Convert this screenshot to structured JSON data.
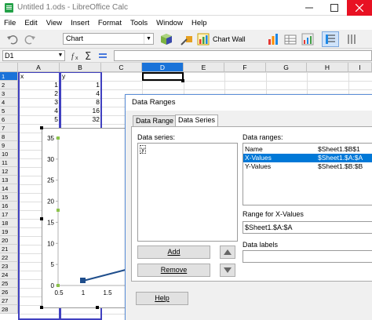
{
  "window": {
    "title": "Untitled 1.ods - LibreOffice Calc"
  },
  "menu": [
    "File",
    "Edit",
    "View",
    "Insert",
    "Format",
    "Tools",
    "Window",
    "Help"
  ],
  "toolbar": {
    "chart_select": "Chart",
    "chart_wall_label": "Chart Wall"
  },
  "formula_bar": {
    "name_box": "D1",
    "formula": ""
  },
  "sheet": {
    "columns": [
      "A",
      "B",
      "C",
      "D",
      "E",
      "F",
      "G",
      "H",
      "I"
    ],
    "selected_column": "D",
    "selected_row": "1",
    "rows": [
      "1",
      "2",
      "3",
      "4",
      "5",
      "6",
      "7",
      "8",
      "9",
      "10",
      "11",
      "12",
      "13",
      "14",
      "15",
      "16",
      "17",
      "18",
      "19",
      "20",
      "21",
      "22",
      "23",
      "24",
      "25",
      "26",
      "27",
      "28"
    ],
    "headers": {
      "a1": "x",
      "b1": "y"
    },
    "data": [
      {
        "x": "1",
        "y": "1"
      },
      {
        "x": "2",
        "y": "4"
      },
      {
        "x": "3",
        "y": "8"
      },
      {
        "x": "4",
        "y": "16"
      },
      {
        "x": "5",
        "y": "32"
      }
    ]
  },
  "chart": {
    "y_ticks": [
      "35",
      "30",
      "25",
      "20",
      "15",
      "10",
      "5",
      "0"
    ],
    "x_ticks": [
      "0.5",
      "1",
      "1.5"
    ]
  },
  "dialog": {
    "title": "Data Ranges",
    "tabs": [
      "Data Range",
      "Data Series"
    ],
    "active_tab": "Data Series",
    "data_series_label": "Data series:",
    "data_series_items": [
      "y"
    ],
    "data_ranges_label": "Data ranges:",
    "data_ranges": [
      {
        "name": "Name",
        "range": "$Sheet1.$B$1"
      },
      {
        "name": "X-Values",
        "range": "$Sheet1.$A:$A"
      },
      {
        "name": "Y-Values",
        "range": "$Sheet1.$B:$B"
      }
    ],
    "selected_range_index": 1,
    "range_for_label": "Range for X-Values",
    "range_for_value": "$Sheet1.$A:$A",
    "data_labels_label": "Data labels",
    "data_labels_value": "",
    "add_button": "Add",
    "remove_button": "Remove",
    "help_button": "Help"
  },
  "colors": {
    "selection": "#1a73d9",
    "highlight": "#0078d7",
    "close": "#e81123",
    "series": "#1f4e8c"
  }
}
